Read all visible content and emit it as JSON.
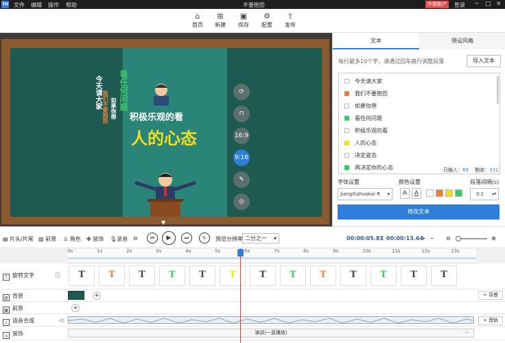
{
  "titlebar": {
    "logo": "TH",
    "menus": [
      "文件",
      "编辑",
      "操作",
      "帮助"
    ],
    "title": "不要抱怨",
    "upgrade": "升级账户",
    "login": "登录"
  },
  "toolbar": {
    "items": [
      {
        "label": "首页",
        "icon": "home-icon"
      },
      {
        "label": "新建",
        "icon": "new-file-icon"
      },
      {
        "label": "保存",
        "icon": "save-icon"
      },
      {
        "label": "配置",
        "icon": "gear-icon"
      },
      {
        "label": "发布",
        "icon": "publish-icon"
      }
    ]
  },
  "canvas": {
    "vertical_texts": [
      "今天请大家",
      "我们不要抱怨",
      "如果你想",
      "看任何问题"
    ],
    "line1": "积极乐观的看",
    "line2": "人的心态",
    "side_buttons": [
      "16:9",
      "9:16"
    ]
  },
  "panel": {
    "tabs": [
      "文本",
      "预设风格"
    ],
    "hint": "每行最多10个字，请通过回车换行调整段落",
    "import_label": "导入文本",
    "lines": [
      {
        "text": "今天请大家",
        "color": ""
      },
      {
        "text": "我们不要抱怨",
        "color": "#e8823a"
      },
      {
        "text": "如果你想",
        "color": ""
      },
      {
        "text": "看任何问题",
        "color": "#3cc864"
      },
      {
        "text": "积极乐观的看",
        "color": ""
      },
      {
        "text": "人的心态",
        "color": "#f0e020"
      },
      {
        "text": "决定姿态",
        "color": ""
      },
      {
        "text": "再决定你的心态",
        "color": "#3cc864"
      }
    ],
    "entered_label": "已输入：",
    "entered_value": "69",
    "remaining_label": "剩余：",
    "remaining_value": "331",
    "font_label": "字体设置",
    "font_value": "JiangXizhuokai R",
    "color_label": "颜色设置",
    "spacing_label": "段落间隔(s)",
    "spacing_value": "0.1",
    "swatches": [
      "#ffffff",
      "#e8823a",
      "#f0e020",
      "#3cc864"
    ],
    "modify_label": "修改文本"
  },
  "controls": {
    "head_tail": "片头/片尾",
    "foreground": "前景",
    "character": "角色",
    "decoration": "装饰",
    "record": "录音",
    "preview_label": "预览分辨率",
    "preview_value": "二分之一",
    "current_time": "00:00:05.81",
    "total_time": "00:00:13.64"
  },
  "timeline": {
    "ticks": [
      "0s",
      "1s",
      "2s",
      "3s",
      "4s",
      "5s",
      "6s",
      "7s",
      "8s",
      "9s",
      "10s",
      "11s",
      "12s",
      "13s"
    ],
    "tracks": {
      "text": "旋转文字",
      "background": "背景",
      "foreground": "前景",
      "voice": "语音合成",
      "decor": "装饰"
    },
    "add_background": "背景",
    "add_voice": "音轨",
    "decor_clip": "演讲(一直播放)"
  }
}
